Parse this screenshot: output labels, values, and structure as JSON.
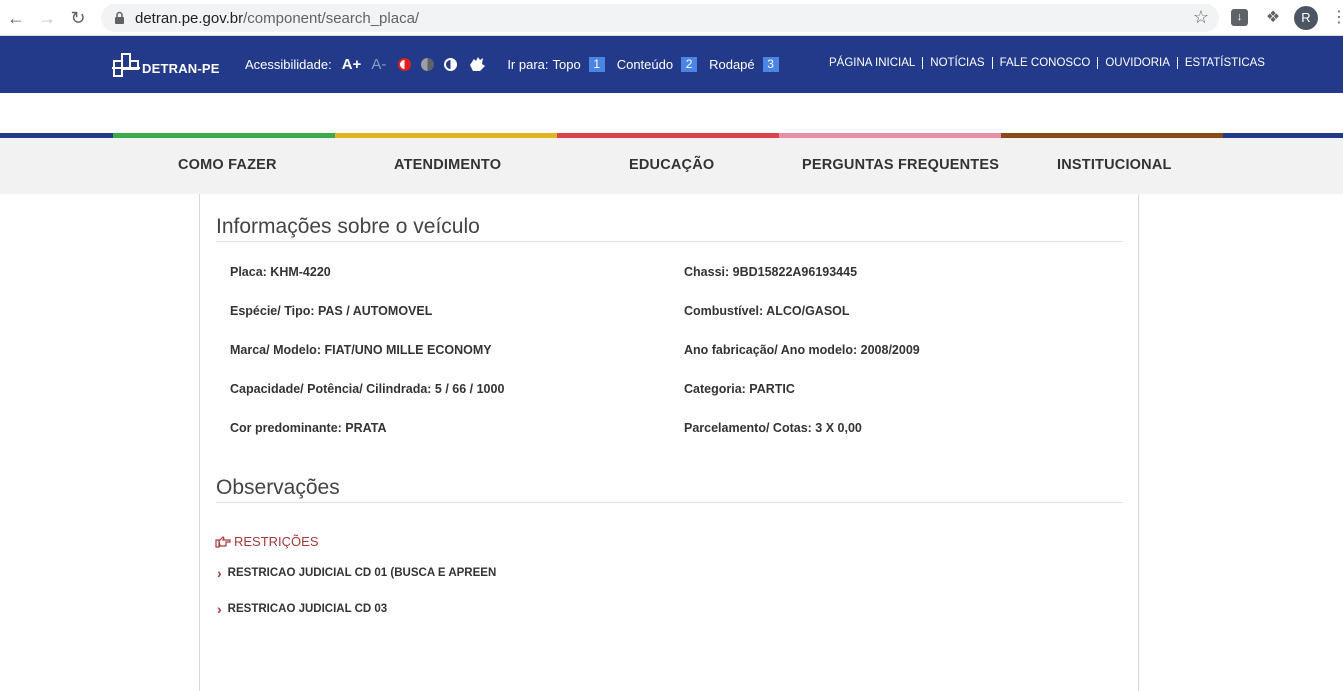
{
  "browser": {
    "url_domain": "detran.pe.gov.br",
    "url_path": "/component/search_placa/",
    "profile_initial": "R"
  },
  "header": {
    "logo_text": "DETRAN-PE",
    "accessibility_label": "Acessibilidade:",
    "font_increase": "A+",
    "font_decrease": "A-",
    "goto_label": "Ir para:",
    "goto_items": [
      {
        "label": "Topo",
        "num": "1"
      },
      {
        "label": "Conteúdo",
        "num": "2"
      },
      {
        "label": "Rodapé",
        "num": "3"
      }
    ],
    "top_links": [
      "PÁGINA INICIAL",
      "NOTÍCIAS",
      "FALE CONOSCO",
      "OUVIDORIA",
      "ESTATÍSTICAS"
    ]
  },
  "stripe_colors": [
    "#233a8b",
    "#3aaa4a",
    "#e3b41f",
    "#d9444d",
    "#e98ea8",
    "#8a4a17",
    "#233a8b"
  ],
  "main_nav": [
    "COMO FAZER",
    "ATENDIMENTO",
    "EDUCAÇÃO",
    "PERGUNTAS FREQUENTES",
    "INSTITUCIONAL"
  ],
  "vehicle": {
    "title": "Informações sobre o veículo",
    "left": [
      "Placa: KHM-4220",
      "Espécie/ Tipo: PAS / AUTOMOVEL",
      "Marca/ Modelo: FIAT/UNO MILLE ECONOMY",
      "Capacidade/ Potência/ Cilindrada: 5 / 66 / 1000",
      "Cor predominante: PRATA"
    ],
    "right": [
      "Chassi: 9BD15822A96193445",
      "Combustível: ALCO/GASOL",
      "Ano fabricação/ Ano modelo: 2008/2009",
      "Categoria: PARTIC",
      "Parcelamento/ Cotas: 3 X 0,00"
    ]
  },
  "observations": {
    "title": "Observações",
    "restrictions_label": "RESTRIÇÕES",
    "items": [
      "RESTRICAO JUDICIAL CD 01 (BUSCA E APREEN",
      "RESTRICAO JUDICIAL CD 03"
    ]
  }
}
